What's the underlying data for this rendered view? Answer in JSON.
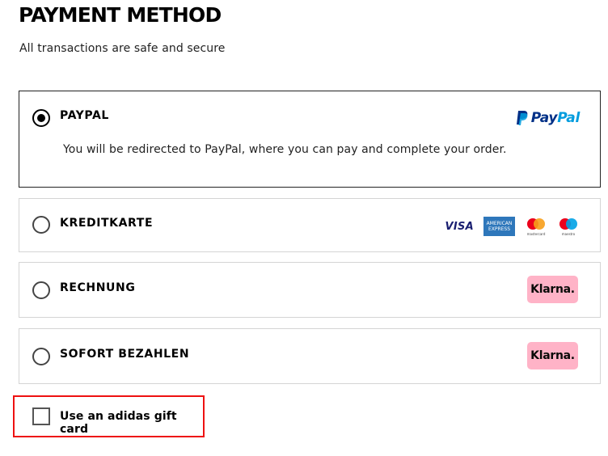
{
  "page": {
    "title": "PAYMENT METHOD",
    "subtitle": "All transactions are safe and secure"
  },
  "options": [
    {
      "label": "PAYPAL",
      "selected": true,
      "description": "You will be redirected to PayPal, where you can pay and complete your order.",
      "logo": {
        "type": "paypal",
        "text_pay": "Pay",
        "text_pal": "Pal",
        "colors": {
          "pay": "#003087",
          "pal": "#009cde"
        }
      }
    },
    {
      "label": "KREDITKARTE",
      "selected": false,
      "logos": [
        {
          "type": "visa",
          "text": "VISA",
          "color": "#1a1f71"
        },
        {
          "type": "amex",
          "line1": "AMERICAN",
          "line2": "EXPRESS",
          "color": "#2e77bb"
        },
        {
          "type": "mastercard",
          "caption": "mastercard",
          "colors": [
            "#eb001b",
            "#f79e1b"
          ]
        },
        {
          "type": "maestro",
          "caption": "maestro",
          "colors": [
            "#eb001b",
            "#00a2e5"
          ]
        }
      ]
    },
    {
      "label": "RECHNUNG",
      "selected": false,
      "logo": {
        "type": "klarna",
        "text": "Klarna.",
        "color": "#ffb3c7"
      }
    },
    {
      "label": "SOFORT BEZAHLEN",
      "selected": false,
      "logo": {
        "type": "klarna",
        "text": "Klarna.",
        "color": "#ffb3c7"
      }
    }
  ],
  "gift_card": {
    "label": "Use an adidas gift card",
    "checked": false,
    "highlight_color": "#e11111"
  }
}
